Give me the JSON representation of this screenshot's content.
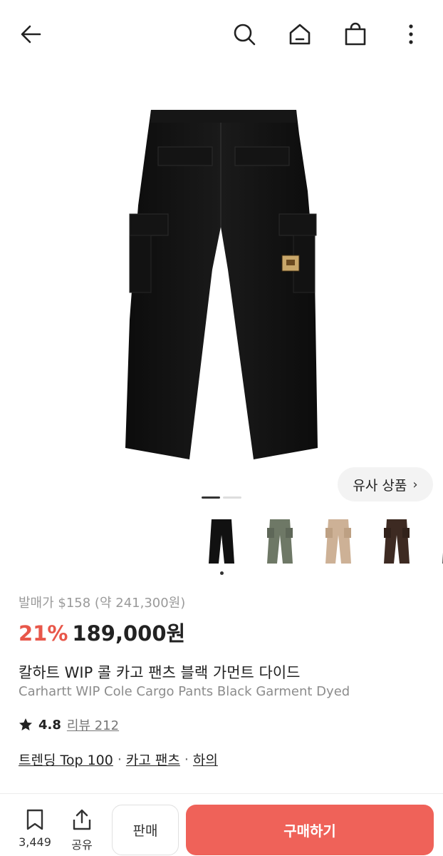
{
  "header": {
    "icons": [
      "arrow-left-icon",
      "search-icon",
      "home-icon",
      "shopping-bag-icon",
      "more-vertical-icon"
    ]
  },
  "gallery": {
    "similar_label": "유사 상품",
    "colors": [
      "black",
      "olive-green",
      "beige",
      "brown",
      "dark-grey"
    ]
  },
  "product": {
    "release_price": "발매가 $158 (약 241,300원)",
    "discount": "21%",
    "price": "189,000원",
    "title_ko": "칼하트 WIP 콜 카고 팬츠 블랙 가먼트 다이드",
    "title_en": "Carhartt WIP Cole Cargo Pants Black Garment Dyed",
    "rating": "4.8",
    "reviews": "리뷰 212"
  },
  "categories": {
    "items": [
      "트렌딩 Top 100",
      "카고 팬츠",
      "하의"
    ],
    "separator": "·"
  },
  "bottom_bar": {
    "save_count": "3,449",
    "share_label": "공유",
    "sell_label": "판매",
    "buy_label": "구매하기"
  },
  "colors": {
    "accent": "#ef6259",
    "discount": "#e8574a"
  }
}
